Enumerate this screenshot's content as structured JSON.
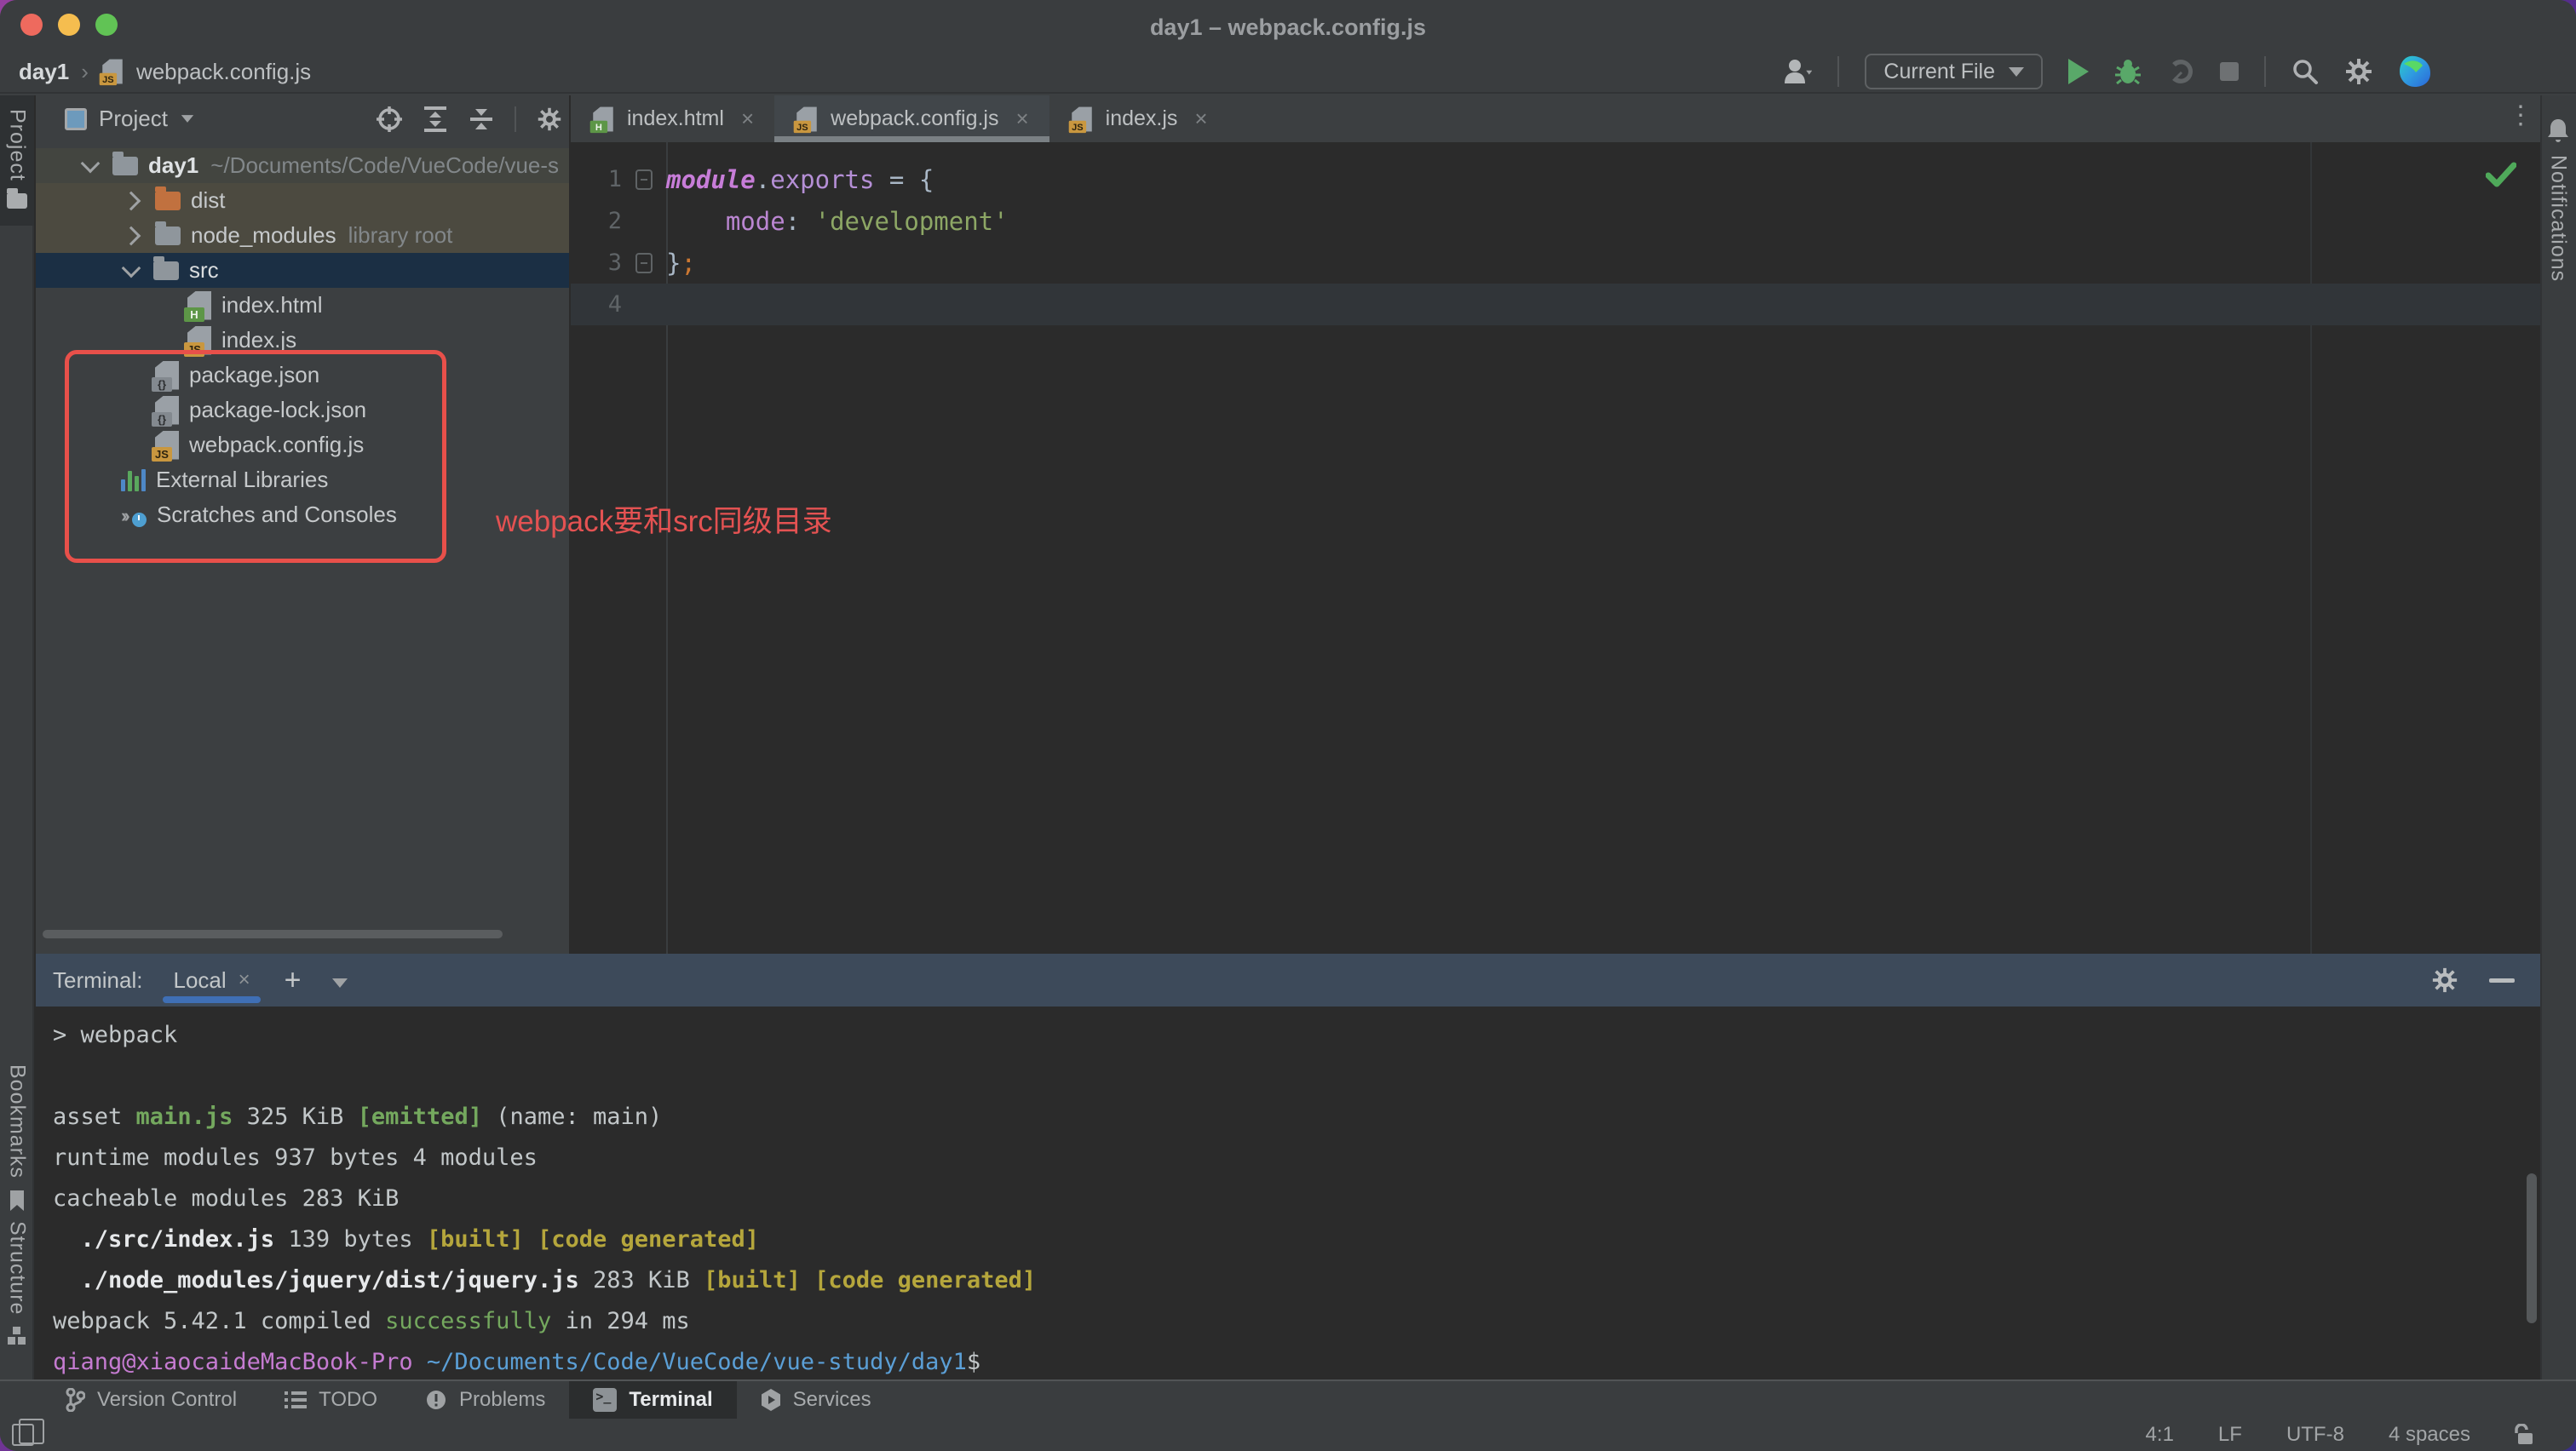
{
  "window": {
    "title": "day1 – webpack.config.js"
  },
  "breadcrumb": {
    "project": "day1",
    "separator": "›",
    "file": "webpack.config.js"
  },
  "toolbar": {
    "run_config": "Current File"
  },
  "stripes": {
    "project": "Project",
    "bookmarks": "Bookmarks",
    "structure": "Structure",
    "notifications": "Notifications"
  },
  "project_panel": {
    "title": "Project",
    "tree": [
      {
        "label": "day1",
        "suffix": "~/Documents/Code/VueCode/vue-s"
      },
      {
        "label": "dist",
        "suffix": ""
      },
      {
        "label": "node_modules",
        "suffix": "library root"
      },
      {
        "label": "src",
        "suffix": ""
      },
      {
        "label": "index.html",
        "suffix": ""
      },
      {
        "label": "index.js",
        "suffix": ""
      },
      {
        "label": "package.json",
        "suffix": ""
      },
      {
        "label": "package-lock.json",
        "suffix": ""
      },
      {
        "label": "webpack.config.js",
        "suffix": ""
      },
      {
        "label": "External Libraries",
        "suffix": ""
      },
      {
        "label": "Scratches and Consoles",
        "suffix": ""
      }
    ]
  },
  "tabs": [
    {
      "label": "index.html",
      "close": "×"
    },
    {
      "label": "webpack.config.js",
      "close": "×"
    },
    {
      "label": "index.js",
      "close": "×"
    }
  ],
  "editor": {
    "more": "⋮",
    "nums": {
      "n1": "1",
      "n2": "2",
      "n3": "3",
      "n4": "4"
    },
    "code": {
      "l1": {
        "a": "module",
        "b": ".",
        "c": "exports",
        "d": " = {"
      },
      "l2": {
        "a": "    ",
        "b": "mode",
        "c": ": ",
        "d": "'development'"
      },
      "l3": {
        "a": "}",
        "b": ";"
      }
    }
  },
  "annotation": {
    "text": "webpack要和src同级目录"
  },
  "terminal": {
    "title": "Terminal:",
    "tab": "Local",
    "close": "×",
    "plus": "+",
    "lines": [
      {
        "s": [
          {
            "t": "> webpack"
          }
        ]
      },
      {
        "s": [
          {
            "t": ""
          }
        ]
      },
      {
        "s": [
          {
            "t": "asset "
          },
          {
            "t": "main.js"
          },
          {
            "t": " 325 KiB "
          },
          {
            "t": "[emitted]"
          },
          {
            "t": " (name: main)"
          }
        ]
      },
      {
        "s": [
          {
            "t": "runtime modules 937 bytes 4 modules"
          }
        ]
      },
      {
        "s": [
          {
            "t": "cacheable modules 283 KiB"
          }
        ]
      },
      {
        "s": [
          {
            "t": "  "
          },
          {
            "t": "./src/index.js"
          },
          {
            "t": " 139 bytes "
          },
          {
            "t": "[built] [code generated]"
          }
        ]
      },
      {
        "s": [
          {
            "t": "  "
          },
          {
            "t": "./node_modules/jquery/dist/jquery.js"
          },
          {
            "t": " 283 KiB "
          },
          {
            "t": "[built] [code generated]"
          }
        ]
      },
      {
        "s": [
          {
            "t": "webpack 5.42.1 compiled "
          },
          {
            "t": "successfully"
          },
          {
            "t": " in 294 ms"
          }
        ]
      },
      {
        "s": [
          {
            "t": "qiang@xiaocaideMacBook-Pro"
          },
          {
            "t": " "
          },
          {
            "t": "~/Documents/Code/VueCode/vue-study/day1"
          },
          {
            "t": "$"
          }
        ]
      }
    ]
  },
  "bottom_bar": {
    "items": [
      {
        "label": "Version Control"
      },
      {
        "label": "TODO"
      },
      {
        "label": "Problems"
      },
      {
        "label": "Terminal"
      },
      {
        "label": "Services"
      }
    ]
  },
  "status_bar": {
    "position": "4:1",
    "line_ending": "LF",
    "encoding": "UTF-8",
    "indent": "4 spaces"
  }
}
